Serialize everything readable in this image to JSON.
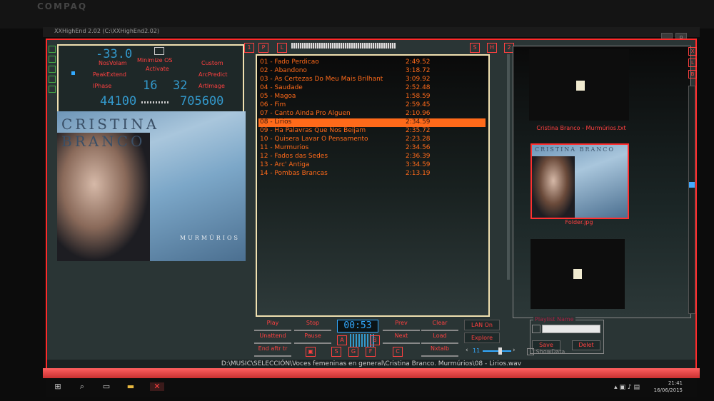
{
  "bezel": {
    "brand": "COMPAQ"
  },
  "window": {
    "title": "XXHighEnd 2.02 (C:\\XXHighEnd2.02)"
  },
  "info": {
    "volume_db": "33.0",
    "minimize_os_label": "Minimize OS",
    "activate_label": "Activate",
    "custom_label": "Custom",
    "nos_label": "NosVolam",
    "peakextend_label": "PeakExtend",
    "arcpredict_label": "ArcPredict",
    "iphase_label": "IPhase",
    "artimage_label": "ArtImage",
    "bits_a": "16",
    "bits_b": "32",
    "rate_in": "44100",
    "rate_out": "705600"
  },
  "cover": {
    "artist": "CRISTINA BRANCO",
    "album": "MURMÚRIOS"
  },
  "mid_tabs": {
    "p": "P",
    "l": "L",
    "s": "S",
    "h": "H",
    "two": "2"
  },
  "playlist": [
    {
      "title": "01 - Fado Perdicao",
      "dur": "2:49.52"
    },
    {
      "title": "02 - Abandono",
      "dur": "3:18.72"
    },
    {
      "title": "03 - As Certezas Do Meu Mais Brilhant",
      "dur": "3:09.92"
    },
    {
      "title": "04 - Saudade",
      "dur": "2:52.48"
    },
    {
      "title": "05 - Magoa",
      "dur": "1:58.59"
    },
    {
      "title": "06 - Fim",
      "dur": "2:59.45"
    },
    {
      "title": "07 - Canto Ainda Pro Alguen",
      "dur": "2:10.96"
    },
    {
      "title": "08 - Lirios",
      "dur": "2:34.59"
    },
    {
      "title": "09 - Ha Palavras Que Nos Beijam",
      "dur": "2:35.72"
    },
    {
      "title": "10 - Quisera Lavar O Pensamento",
      "dur": "2:23.28"
    },
    {
      "title": "11 - Murmurios",
      "dur": "2:34.56"
    },
    {
      "title": "12 - Fados das Sedes",
      "dur": "2:36.39"
    },
    {
      "title": "13 - Arc' Antiga",
      "dur": "3:34.59"
    },
    {
      "title": "14 - Pombas Brancas",
      "dur": "2:13.19"
    }
  ],
  "right": {
    "txt_caption": "Cristina Branco - Murmúrios.txt",
    "jpg_caption": "Folder.jpg",
    "tab_x": "X",
    "tab_l": "L",
    "tab_b": "B"
  },
  "controls": {
    "play": "Play",
    "stop": "Stop",
    "time": "00:53",
    "prev": "Prev",
    "clear": "Clear",
    "unattend": "Unattend",
    "pause": "Pause",
    "next": "Next",
    "load": "Load",
    "endafter": "End aftr tr",
    "nxtalb": "Nxtalb",
    "a": "A",
    "b": "B",
    "s": "S",
    "g": "G",
    "f": "F",
    "c": "C"
  },
  "net": {
    "lan": "LAN On",
    "explore": "Explore",
    "volume_value": "11"
  },
  "playlistname": {
    "legend": "Playlist Name",
    "save": "Save",
    "delete": "Delet",
    "showdata": "ShowData"
  },
  "status": {
    "path": "D:\\MUSIC\\SELECCIÓN\\Voces femeninas en general\\Cristina Branco. Murmúrios\\08 - Lirios.wav"
  },
  "taskbar": {
    "time": "21:41",
    "date": "16/06/2015"
  },
  "colors": {
    "accent": "#ff2a2a",
    "playlist_text": "#ff6a1a",
    "lcd": "#33aaff"
  }
}
